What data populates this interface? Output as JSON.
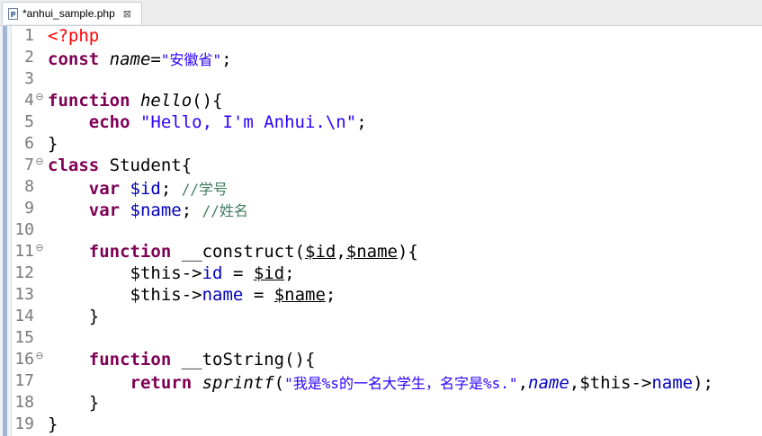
{
  "tab": {
    "title": "*anhui_sample.php",
    "close_glyph": "⊠",
    "icon_letter": "P"
  },
  "colors": {
    "keyword": "#7f0055",
    "string": "#2a00ff",
    "comment": "#3f7f5f",
    "php_tag": "#ff0000",
    "field": "#0000c0",
    "line_number": "#7a7a7a"
  },
  "lines": [
    {
      "n": "1",
      "fold": "",
      "tokens": [
        {
          "t": "<?php",
          "c": "tag"
        }
      ]
    },
    {
      "n": "2",
      "fold": "",
      "tokens": [
        {
          "t": "const ",
          "c": "kw"
        },
        {
          "t": "name",
          "c": "fn"
        },
        {
          "t": "=",
          "c": ""
        },
        {
          "t": "\"安徽省\"",
          "c": "st"
        },
        {
          "t": ";",
          "c": ""
        }
      ]
    },
    {
      "n": "3",
      "fold": "",
      "tokens": []
    },
    {
      "n": "4",
      "fold": "⊖",
      "tokens": [
        {
          "t": "function ",
          "c": "kw"
        },
        {
          "t": "hello",
          "c": "fn"
        },
        {
          "t": "(){",
          "c": ""
        }
      ]
    },
    {
      "n": "5",
      "fold": "",
      "tokens": [
        {
          "t": "    ",
          "c": ""
        },
        {
          "t": "echo ",
          "c": "kw"
        },
        {
          "t": "\"Hello, I'm Anhui.\\n\"",
          "c": "st"
        },
        {
          "t": ";",
          "c": ""
        }
      ]
    },
    {
      "n": "6",
      "fold": "",
      "tokens": [
        {
          "t": "}",
          "c": ""
        }
      ]
    },
    {
      "n": "7",
      "fold": "⊖",
      "tokens": [
        {
          "t": "class ",
          "c": "kw"
        },
        {
          "t": "Student",
          "c": ""
        },
        {
          "t": "{",
          "c": ""
        }
      ]
    },
    {
      "n": "8",
      "fold": "",
      "tokens": [
        {
          "t": "    ",
          "c": ""
        },
        {
          "t": "var ",
          "c": "kw"
        },
        {
          "t": "$id",
          "c": "prop"
        },
        {
          "t": "; ",
          "c": ""
        },
        {
          "t": "//学号",
          "c": "cm"
        }
      ]
    },
    {
      "n": "9",
      "fold": "",
      "tokens": [
        {
          "t": "    ",
          "c": ""
        },
        {
          "t": "var ",
          "c": "kw"
        },
        {
          "t": "$name",
          "c": "prop"
        },
        {
          "t": "; ",
          "c": ""
        },
        {
          "t": "//姓名",
          "c": "cm"
        }
      ]
    },
    {
      "n": "10",
      "fold": "",
      "tokens": []
    },
    {
      "n": "11",
      "fold": "⊖",
      "tokens": [
        {
          "t": "    ",
          "c": ""
        },
        {
          "t": "function ",
          "c": "kw"
        },
        {
          "t": "__construct(",
          "c": ""
        },
        {
          "t": "$id",
          "c": "u"
        },
        {
          "t": ",",
          "c": ""
        },
        {
          "t": "$name",
          "c": "u"
        },
        {
          "t": "){",
          "c": ""
        }
      ]
    },
    {
      "n": "12",
      "fold": "",
      "tokens": [
        {
          "t": "        ",
          "c": ""
        },
        {
          "t": "$this",
          "c": ""
        },
        {
          "t": "->",
          "c": ""
        },
        {
          "t": "id",
          "c": "prop"
        },
        {
          "t": " = ",
          "c": ""
        },
        {
          "t": "$id",
          "c": "u"
        },
        {
          "t": ";",
          "c": ""
        }
      ]
    },
    {
      "n": "13",
      "fold": "",
      "tokens": [
        {
          "t": "        ",
          "c": ""
        },
        {
          "t": "$this",
          "c": ""
        },
        {
          "t": "->",
          "c": ""
        },
        {
          "t": "name",
          "c": "prop"
        },
        {
          "t": " = ",
          "c": ""
        },
        {
          "t": "$name",
          "c": "u"
        },
        {
          "t": ";",
          "c": ""
        }
      ]
    },
    {
      "n": "14",
      "fold": "",
      "tokens": [
        {
          "t": "    ",
          "c": ""
        },
        {
          "t": "}",
          "c": ""
        }
      ]
    },
    {
      "n": "15",
      "fold": "",
      "tokens": []
    },
    {
      "n": "16",
      "fold": "⊖",
      "tokens": [
        {
          "t": "    ",
          "c": ""
        },
        {
          "t": "function ",
          "c": "kw"
        },
        {
          "t": "__toString(){",
          "c": ""
        }
      ]
    },
    {
      "n": "17",
      "fold": "",
      "tokens": [
        {
          "t": "        ",
          "c": ""
        },
        {
          "t": "return ",
          "c": "kw"
        },
        {
          "t": "sprintf",
          "c": "fn"
        },
        {
          "t": "(",
          "c": ""
        },
        {
          "t": "\"我是%s的一名大学生，名字是%s.\"",
          "c": "st"
        },
        {
          "t": ",",
          "c": ""
        },
        {
          "t": "name",
          "c": "fn prop"
        },
        {
          "t": ",",
          "c": ""
        },
        {
          "t": "$this",
          "c": ""
        },
        {
          "t": "->",
          "c": ""
        },
        {
          "t": "name",
          "c": "prop"
        },
        {
          "t": ");",
          "c": ""
        }
      ]
    },
    {
      "n": "18",
      "fold": "",
      "tokens": [
        {
          "t": "    ",
          "c": ""
        },
        {
          "t": "}",
          "c": ""
        }
      ]
    },
    {
      "n": "19",
      "fold": "",
      "tokens": [
        {
          "t": "}",
          "c": ""
        }
      ]
    }
  ]
}
